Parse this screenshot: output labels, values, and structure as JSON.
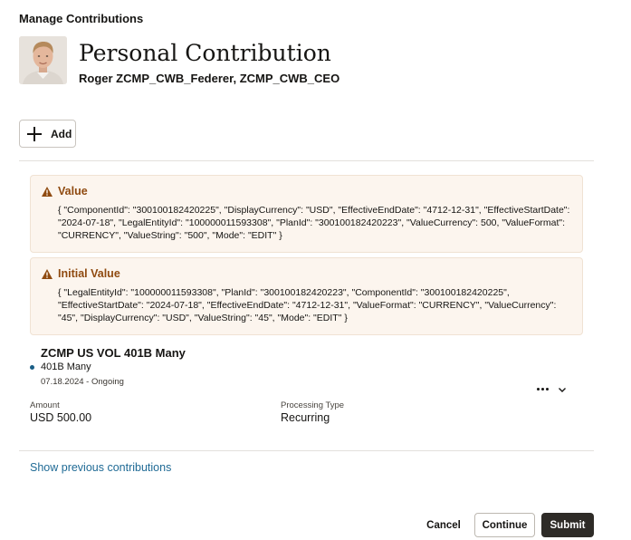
{
  "page": {
    "header": "Manage Contributions"
  },
  "person": {
    "title": "Personal Contribution",
    "name": "Roger ZCMP_CWB_Federer, ZCMP_CWB_CEO"
  },
  "toolbar": {
    "add_label": "Add"
  },
  "alerts": [
    {
      "title": "Value",
      "body": "{ \"ComponentId\": \"300100182420225\", \"DisplayCurrency\": \"USD\", \"EffectiveEndDate\": \"4712-12-31\", \"EffectiveStartDate\": \"2024-07-18\", \"LegalEntityId\": \"100000011593308\", \"PlanId\": \"300100182420223\", \"ValueCurrency\": 500, \"ValueFormat\": \"CURRENCY\", \"ValueString\": \"500\", \"Mode\": \"EDIT\" }"
    },
    {
      "title": "Initial Value",
      "body": "{ \"LegalEntityId\": \"100000011593308\", \"PlanId\": \"300100182420223\", \"ComponentId\": \"300100182420225\", \"EffectiveStartDate\": \"2024-07-18\", \"EffectiveEndDate\": \"4712-12-31\", \"ValueFormat\": \"CURRENCY\", \"ValueCurrency\": \"45\", \"DisplayCurrency\": \"USD\", \"ValueString\": \"45\", \"Mode\": \"EDIT\" }"
    }
  ],
  "contribution": {
    "plan": "ZCMP US VOL 401B Many",
    "option": "401B Many",
    "period": "07.18.2024 - Ongoing",
    "amount_label": "Amount",
    "amount_value": "USD 500.00",
    "processing_label": "Processing Type",
    "processing_value": "Recurring"
  },
  "links": {
    "show_previous": "Show previous contributions"
  },
  "footer": {
    "cancel": "Cancel",
    "continue": "Continue",
    "submit": "Submit"
  },
  "icons": {
    "add": "plus-icon",
    "warning": "warning-icon",
    "more": "more-icon",
    "expand": "chevron-down-icon"
  },
  "colors": {
    "warning": "#8f4a10",
    "link": "#1f6a95",
    "primary_button": "#2e2b27"
  }
}
